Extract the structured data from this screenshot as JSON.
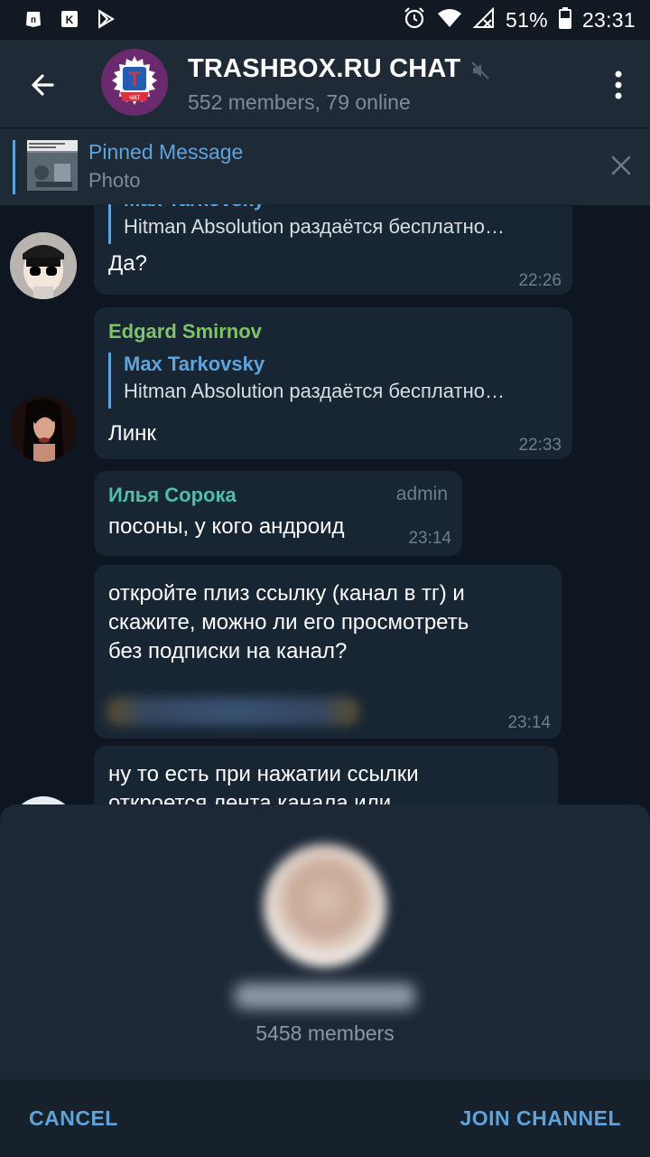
{
  "status_bar": {
    "left_icons": [
      "pikabu-app-icon",
      "vk-app-icon",
      "play-store-icon"
    ],
    "alarm_icon": "alarm-icon",
    "wifi_icon": "wifi-icon",
    "signal_icon": "signal-icon",
    "battery": "51%",
    "battery_icon": "battery-icon",
    "time": "23:31"
  },
  "header": {
    "title": "TRASHBOX.RU CHAT",
    "subtitle": "552 members, 79 online",
    "avatar_letter": "T",
    "avatar_text": "чат",
    "muted_icon": "muted-speaker-icon",
    "back_icon": "back-arrow-icon",
    "more_icon": "more-vertical-icon"
  },
  "pinned": {
    "title": "Pinned Message",
    "subtitle": "Photo",
    "close_icon": "close-icon"
  },
  "messages": [
    {
      "reply_name": "Max Tarkovsky",
      "reply_text": "Hitman Absolution раздаётся бесплатно…",
      "text": "Да?",
      "time": "22:26"
    },
    {
      "author": "Edgard Smirnov",
      "reply_name": "Max Tarkovsky",
      "reply_text": "Hitman Absolution раздаётся бесплатно…",
      "text": "Линк",
      "time": "22:33"
    },
    {
      "author": "Илья Сорока",
      "badge": "admin",
      "text": "посоны, у кого андроид",
      "time": "23:14"
    },
    {
      "text_lines": [
        "откройте плиз ссылку (канал в тг) и",
        "скажите, можно ли его просмотреть",
        "без подписки на канал?"
      ],
      "time": "23:14"
    },
    {
      "text_lines": [
        "ну то есть при нажатии ссылки",
        "откроется лента канала или"
      ]
    }
  ],
  "sheet": {
    "members": "5458 members",
    "cancel": "CANCEL",
    "join": "JOIN CHANNEL"
  },
  "colors": {
    "background": "#0e1621",
    "bar": "#1f2a37",
    "bubble": "#182533",
    "accent": "#5ea4da",
    "name_green": "#7ec26a",
    "name_teal": "#4ec0a8"
  }
}
